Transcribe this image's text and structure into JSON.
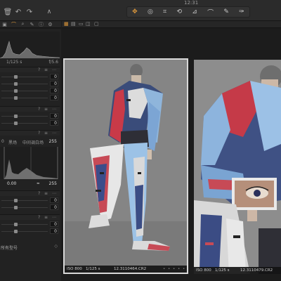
{
  "window": {
    "title": "12:31"
  },
  "toolbar": {
    "left_icons": [
      "trash-icon",
      "undo-icon",
      "redo-icon",
      "brush-icon"
    ],
    "tools": [
      "pan-icon",
      "rotate-icon",
      "crop-icon",
      "straighten-icon",
      "keystone-icon",
      "picker-icon",
      "eraser-icon",
      "annotate-icon"
    ]
  },
  "left_tabs": [
    "camera-tab",
    "histogram-tab",
    "search-tab",
    "brush-tab",
    "info-tab",
    "gear-tab"
  ],
  "histogram": {
    "shutter": "1/125 s",
    "aperture": "f/5.6"
  },
  "levels": {
    "min_label": "0",
    "mid_label_1": "黑场",
    "mid_label_2": "中间调",
    "white_label": "白场",
    "max_value": "255",
    "bottom_left": "0.00",
    "bottom_right": "255"
  },
  "adjust_values": [
    "0",
    "0",
    "0",
    "0",
    "0",
    "0",
    "0",
    "0",
    "0",
    "0"
  ],
  "bottom_dropdown": "所有型号",
  "browser": {
    "thumbs": [
      {
        "iso": "ISO 800",
        "shutter": "1/125 s",
        "file": "12.3110464.CR2",
        "rating": "• • • • •"
      },
      {
        "iso": "ISO 800",
        "shutter": "1/125 s",
        "file": "12.3110479.CR2"
      }
    ]
  },
  "colors": {
    "accent": "#e39b3b",
    "panel": "#222222",
    "selection_border": "#d8d8d8"
  }
}
